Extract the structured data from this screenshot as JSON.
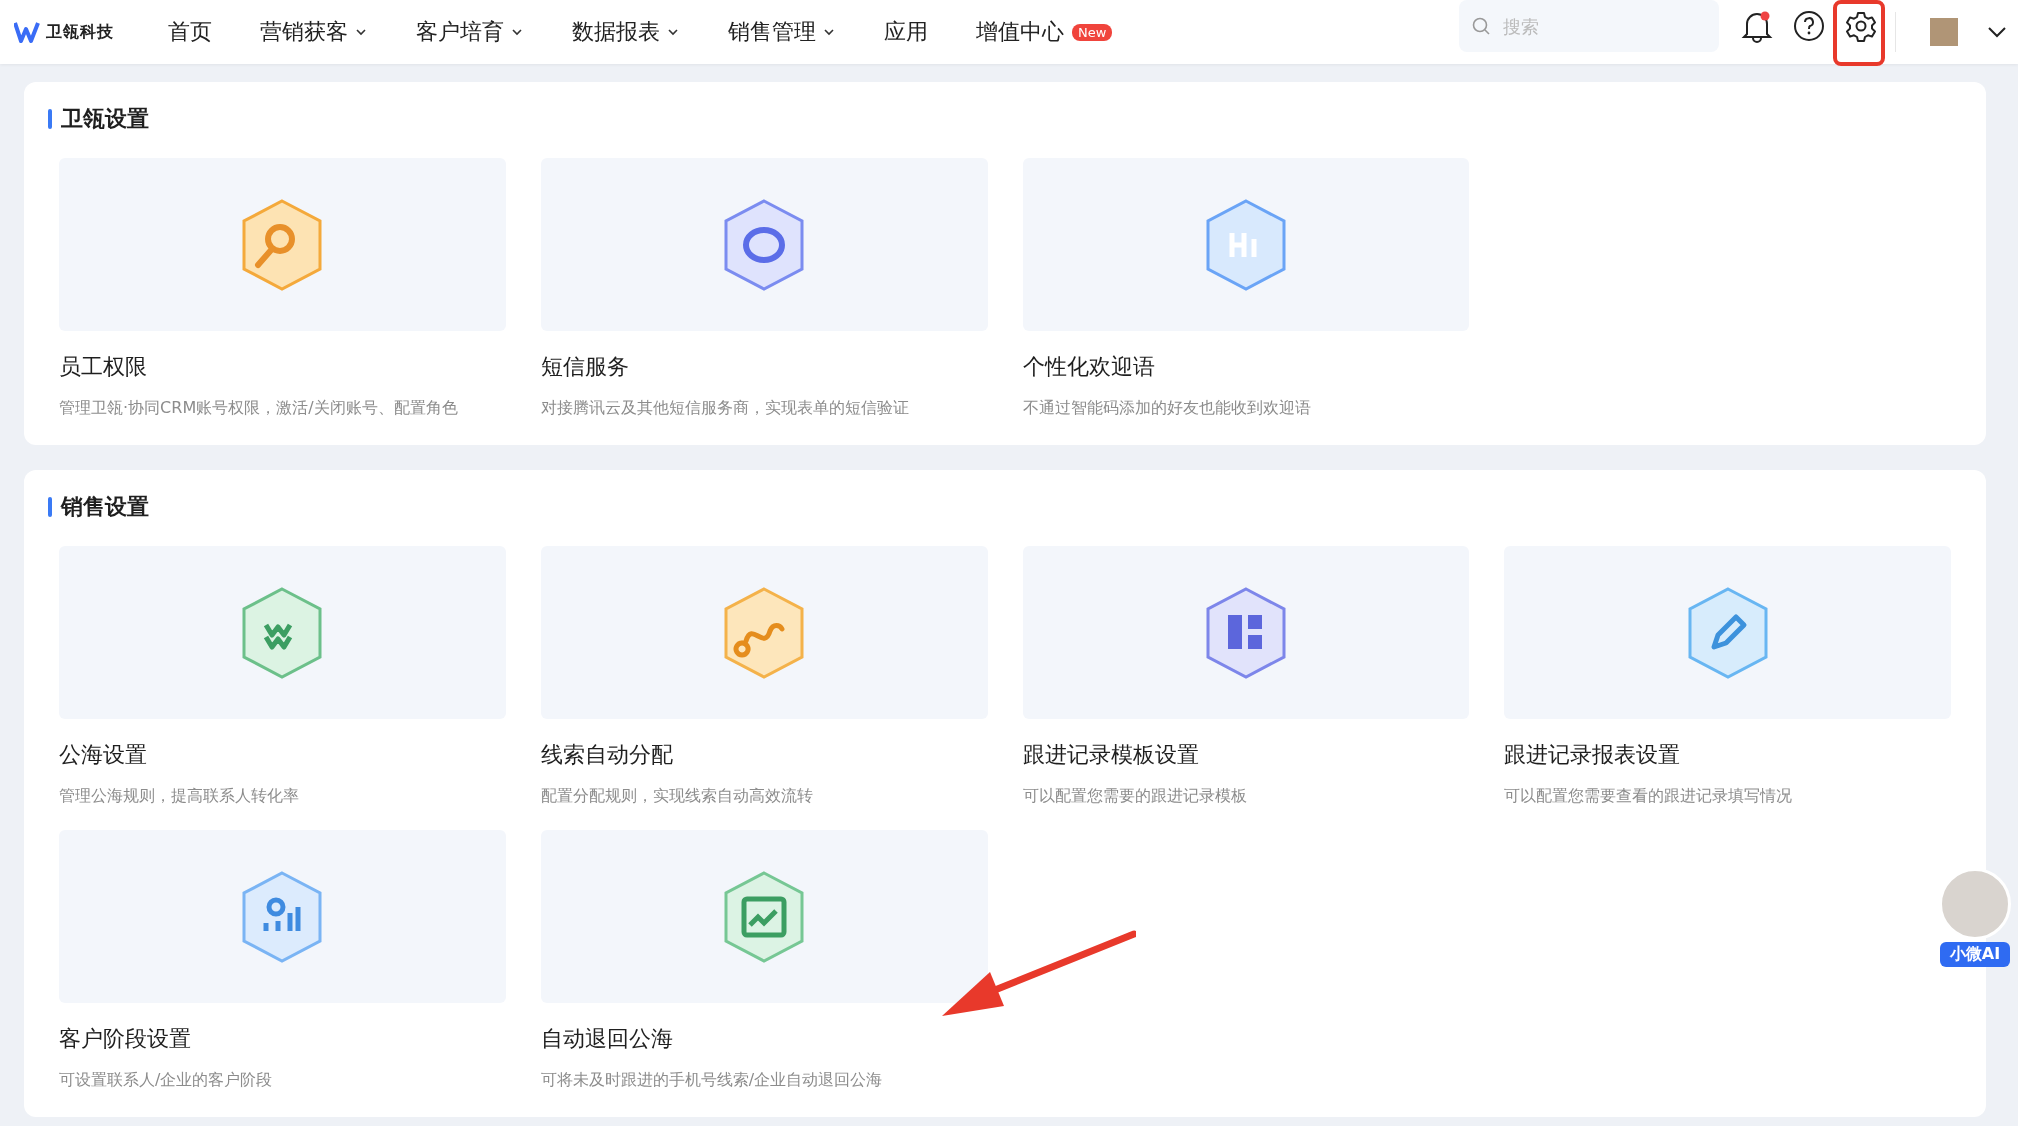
{
  "topbar": {
    "logo_text": "卫瓴科技",
    "nav": [
      {
        "label": "首页",
        "has_menu": false
      },
      {
        "label": "营销获客",
        "has_menu": true
      },
      {
        "label": "客户培育",
        "has_menu": true
      },
      {
        "label": "数据报表",
        "has_menu": true
      },
      {
        "label": "销售管理",
        "has_menu": true
      },
      {
        "label": "应用",
        "has_menu": false
      },
      {
        "label": "增值中心",
        "has_menu": false,
        "badge": "New"
      }
    ],
    "search": {
      "placeholder": "搜索"
    },
    "notification_dot": true,
    "settings_highlighted": true
  },
  "sections": [
    {
      "title": "卫瓴设置",
      "items": [
        {
          "title": "员工权限",
          "description": "管理卫瓴·协同CRM账号权限，激活/关闭账号、配置角色"
        },
        {
          "title": "短信服务",
          "description": "对接腾讯云及其他短信服务商，实现表单的短信验证"
        },
        {
          "title": "个性化欢迎语",
          "description": "不通过智能码添加的好友也能收到欢迎语"
        }
      ]
    },
    {
      "title": "销售设置",
      "items": [
        {
          "title": "公海设置",
          "description": "管理公海规则，提高联系人转化率"
        },
        {
          "title": "线索自动分配",
          "description": "配置分配规则，实现线索自动高效流转"
        },
        {
          "title": "跟进记录模板设置",
          "description": "可以配置您需要的跟进记录模板"
        },
        {
          "title": "跟进记录报表设置",
          "description": "可以配置您需要查看的跟进记录填写情况"
        },
        {
          "title": "客户阶段设置",
          "description": "可设置联系人/企业的客户阶段"
        },
        {
          "title": "自动退回公海",
          "description": "可将未及时跟进的手机号线索/企业自动退回公海"
        }
      ]
    }
  ],
  "assistant": {
    "label": "小微AI"
  },
  "pointer_arrow": true
}
